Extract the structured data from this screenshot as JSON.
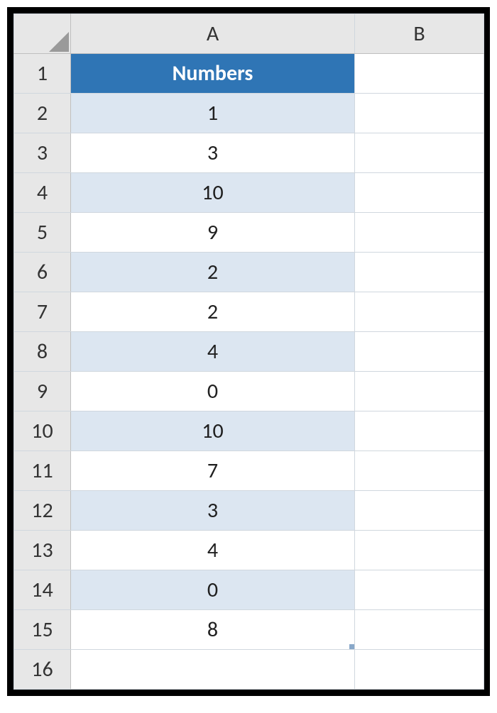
{
  "columns": {
    "A": "A",
    "B": "B"
  },
  "row_headers": [
    "1",
    "2",
    "3",
    "4",
    "5",
    "6",
    "7",
    "8",
    "9",
    "10",
    "11",
    "12",
    "13",
    "14",
    "15",
    "16"
  ],
  "sheet": {
    "header_label": "Numbers",
    "header_bg": "#2f75b5",
    "band_color": "#dce6f1",
    "values": [
      "1",
      "3",
      "10",
      "9",
      "2",
      "2",
      "4",
      "0",
      "10",
      "7",
      "3",
      "4",
      "0",
      "8"
    ]
  }
}
